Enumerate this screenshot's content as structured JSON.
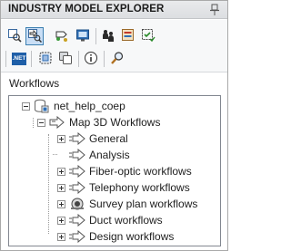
{
  "panel": {
    "title": "INDUSTRY MODEL EXPLORER",
    "section_label": "Workflows"
  },
  "toolbar": {
    "row1": [
      {
        "icon": "connect-icon",
        "active": false
      },
      {
        "icon": "workflow-explorer-icon",
        "active": true
      },
      {
        "icon": "topology-icon",
        "active": false
      },
      {
        "icon": "display-model-icon",
        "active": false
      },
      {
        "icon": "users-icon",
        "active": false
      },
      {
        "icon": "form-designer-icon",
        "active": false
      },
      {
        "icon": "checklist-icon",
        "active": false
      }
    ],
    "row2": [
      {
        "icon": "dotnet-icon",
        "label": ".NET"
      },
      {
        "icon": "select-frame-icon"
      },
      {
        "icon": "layers-icon"
      },
      {
        "icon": "info-icon"
      },
      {
        "icon": "find-icon"
      }
    ]
  },
  "tree": {
    "root": "net_help_coep",
    "group": "Map 3D Workflows",
    "items": [
      {
        "label": "General",
        "expandable": true,
        "icon": "workflow-arrow-icon"
      },
      {
        "label": "Analysis",
        "expandable": false,
        "icon": "workflow-arrow-icon"
      },
      {
        "label": "Fiber-optic workflows",
        "expandable": true,
        "icon": "workflow-arrow-icon"
      },
      {
        "label": "Telephony workflows",
        "expandable": true,
        "icon": "workflow-arrow-icon"
      },
      {
        "label": "Survey plan workflows",
        "expandable": true,
        "icon": "survey-plan-icon"
      },
      {
        "label": "Duct workflows",
        "expandable": true,
        "icon": "workflow-arrow-icon"
      },
      {
        "label": "Design workflows",
        "expandable": true,
        "icon": "workflow-arrow-icon"
      }
    ]
  },
  "colors": {
    "active_button_bg": "#c9def5",
    "active_button_border": "#3c7fb1",
    "dotnet_blue": "#1f5fa8"
  }
}
